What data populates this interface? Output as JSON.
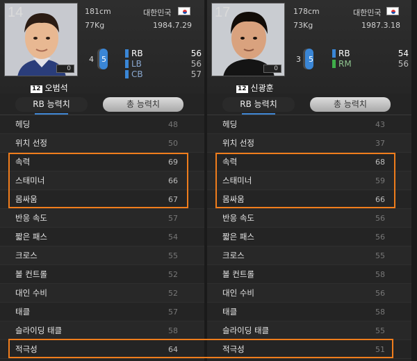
{
  "players": [
    {
      "number": "14",
      "rating": "0",
      "pos_badge": "12",
      "name": "오범석",
      "height": "181cm",
      "weight": "77Kg",
      "nation": "대한민국",
      "birth": "1984.7.29",
      "foot_left": "4",
      "foot_right": "5",
      "positions": [
        {
          "code": "RB",
          "value": "56",
          "color": "#3a86d6",
          "active": true
        },
        {
          "code": "LB",
          "value": "56",
          "color": "#3a86d6",
          "active": false
        },
        {
          "code": "CB",
          "value": "57",
          "color": "#3a86d6",
          "active": false
        }
      ],
      "tabs": {
        "active": "RB 능력치",
        "inactive": "총 능력치"
      },
      "stats": [
        {
          "label": "헤딩",
          "value": "48"
        },
        {
          "label": "위치 선정",
          "value": "50"
        },
        {
          "label": "속력",
          "value": "69"
        },
        {
          "label": "스태미너",
          "value": "66"
        },
        {
          "label": "몸싸움",
          "value": "67"
        },
        {
          "label": "반응 속도",
          "value": "57"
        },
        {
          "label": "짧은 패스",
          "value": "54"
        },
        {
          "label": "크로스",
          "value": "55"
        },
        {
          "label": "볼 컨트롤",
          "value": "52"
        },
        {
          "label": "대인 수비",
          "value": "52"
        },
        {
          "label": "태클",
          "value": "57"
        },
        {
          "label": "슬라이딩 태클",
          "value": "58"
        },
        {
          "label": "적극성",
          "value": "64"
        }
      ]
    },
    {
      "number": "17",
      "rating": "0",
      "pos_badge": "12",
      "name": "신광훈",
      "height": "178cm",
      "weight": "73Kg",
      "nation": "대한민국",
      "birth": "1987.3.18",
      "foot_left": "3",
      "foot_right": "5",
      "positions": [
        {
          "code": "RB",
          "value": "54",
          "color": "#3a86d6",
          "active": true
        },
        {
          "code": "RM",
          "value": "56",
          "color": "#3fae4a",
          "active": false
        }
      ],
      "tabs": {
        "active": "RB 능력치",
        "inactive": "총 능력치"
      },
      "stats": [
        {
          "label": "헤딩",
          "value": "43"
        },
        {
          "label": "위치 선정",
          "value": "37"
        },
        {
          "label": "속력",
          "value": "68"
        },
        {
          "label": "스태미너",
          "value": "59"
        },
        {
          "label": "몸싸움",
          "value": "66"
        },
        {
          "label": "반응 속도",
          "value": "56"
        },
        {
          "label": "짧은 패스",
          "value": "56"
        },
        {
          "label": "크로스",
          "value": "55"
        },
        {
          "label": "볼 컨트롤",
          "value": "58"
        },
        {
          "label": "대인 수비",
          "value": "56"
        },
        {
          "label": "태클",
          "value": "58"
        },
        {
          "label": "슬라이딩 태클",
          "value": "55"
        },
        {
          "label": "적극성",
          "value": "51"
        }
      ]
    }
  ],
  "colors": {
    "highlight": "#f07d1c",
    "accent": "#3f86d4"
  }
}
